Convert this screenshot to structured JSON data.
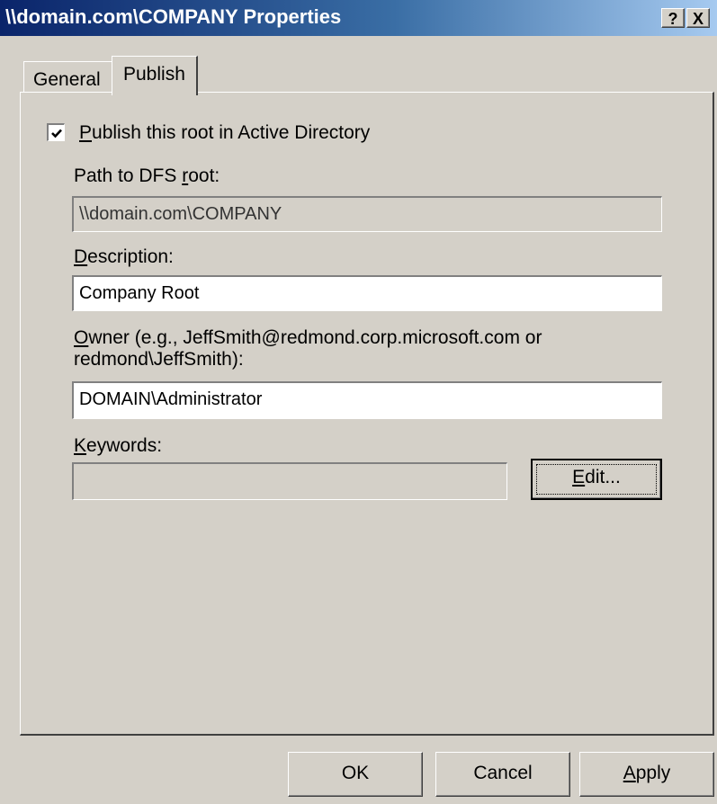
{
  "window": {
    "title": "\\\\domain.com\\COMPANY Properties",
    "help_button": "?",
    "close_button": "X"
  },
  "tabs": [
    {
      "label": "General",
      "selected": false
    },
    {
      "label": "Publish",
      "selected": true
    }
  ],
  "publish": {
    "checkbox_checked": true,
    "checkbox_label_mnemonic": "P",
    "checkbox_label_rest": "ublish this root in Active Directory",
    "path_label_prefix": "Path to DFS ",
    "path_label_mnemonic": "r",
    "path_label_rest": "oot:",
    "path_value": "\\\\domain.com\\COMPANY",
    "description_label_mnemonic": "D",
    "description_label_rest": "escription:",
    "description_value": "Company Root",
    "owner_label_mnemonic": "O",
    "owner_label_line1_rest": "wner (e.g., JeffSmith@redmond.corp.microsoft.com or",
    "owner_label_line2": "redmond\\JeffSmith):",
    "owner_value": "DOMAIN\\Administrator",
    "keywords_label_mnemonic": "K",
    "keywords_label_rest": "eywords:",
    "keywords_value": "",
    "edit_button_mnemonic": "E",
    "edit_button_rest": "dit..."
  },
  "buttons": {
    "ok": "OK",
    "cancel": "Cancel",
    "apply_mnemonic": "A",
    "apply_rest": "pply"
  }
}
